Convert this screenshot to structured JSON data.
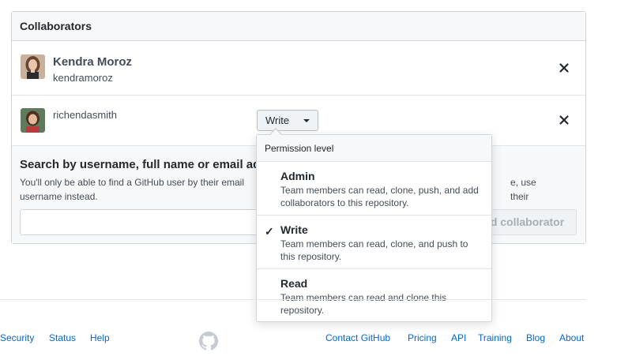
{
  "section": {
    "title": "Collaborators"
  },
  "collaborators": [
    {
      "full_name": "Kendra Moroz",
      "login": "kendramoroz"
    },
    {
      "login": "richendasmith",
      "permission": "Write"
    }
  ],
  "search": {
    "title": "Search by username, full name or email addr",
    "help": "You'll only be able to find a GitHub user by their email",
    "help_tail": "e, use their",
    "help_line2": "username instead.",
    "input_value": "",
    "add_button": "d collaborator"
  },
  "permission_menu": {
    "header": "Permission level",
    "options": [
      {
        "title": "Admin",
        "description": "Team members can read, clone, push, and add collaborators to this repository.",
        "selected": false
      },
      {
        "title": "Write",
        "description": "Team members can read, clone, and push to this repository.",
        "selected": true
      },
      {
        "title": "Read",
        "description": "Team members can read and clone this repository.",
        "selected": false
      }
    ],
    "check_glyph": "✓"
  },
  "footer": {
    "left_links": [
      "Security",
      "Status",
      "Help"
    ],
    "right_links": [
      "Contact GitHub",
      "Pricing",
      "API",
      "Training",
      "Blog",
      "About"
    ]
  },
  "colors": {
    "link": "#0366d6",
    "header_bg": "#f6f8fa",
    "border": "#d1d5da"
  }
}
